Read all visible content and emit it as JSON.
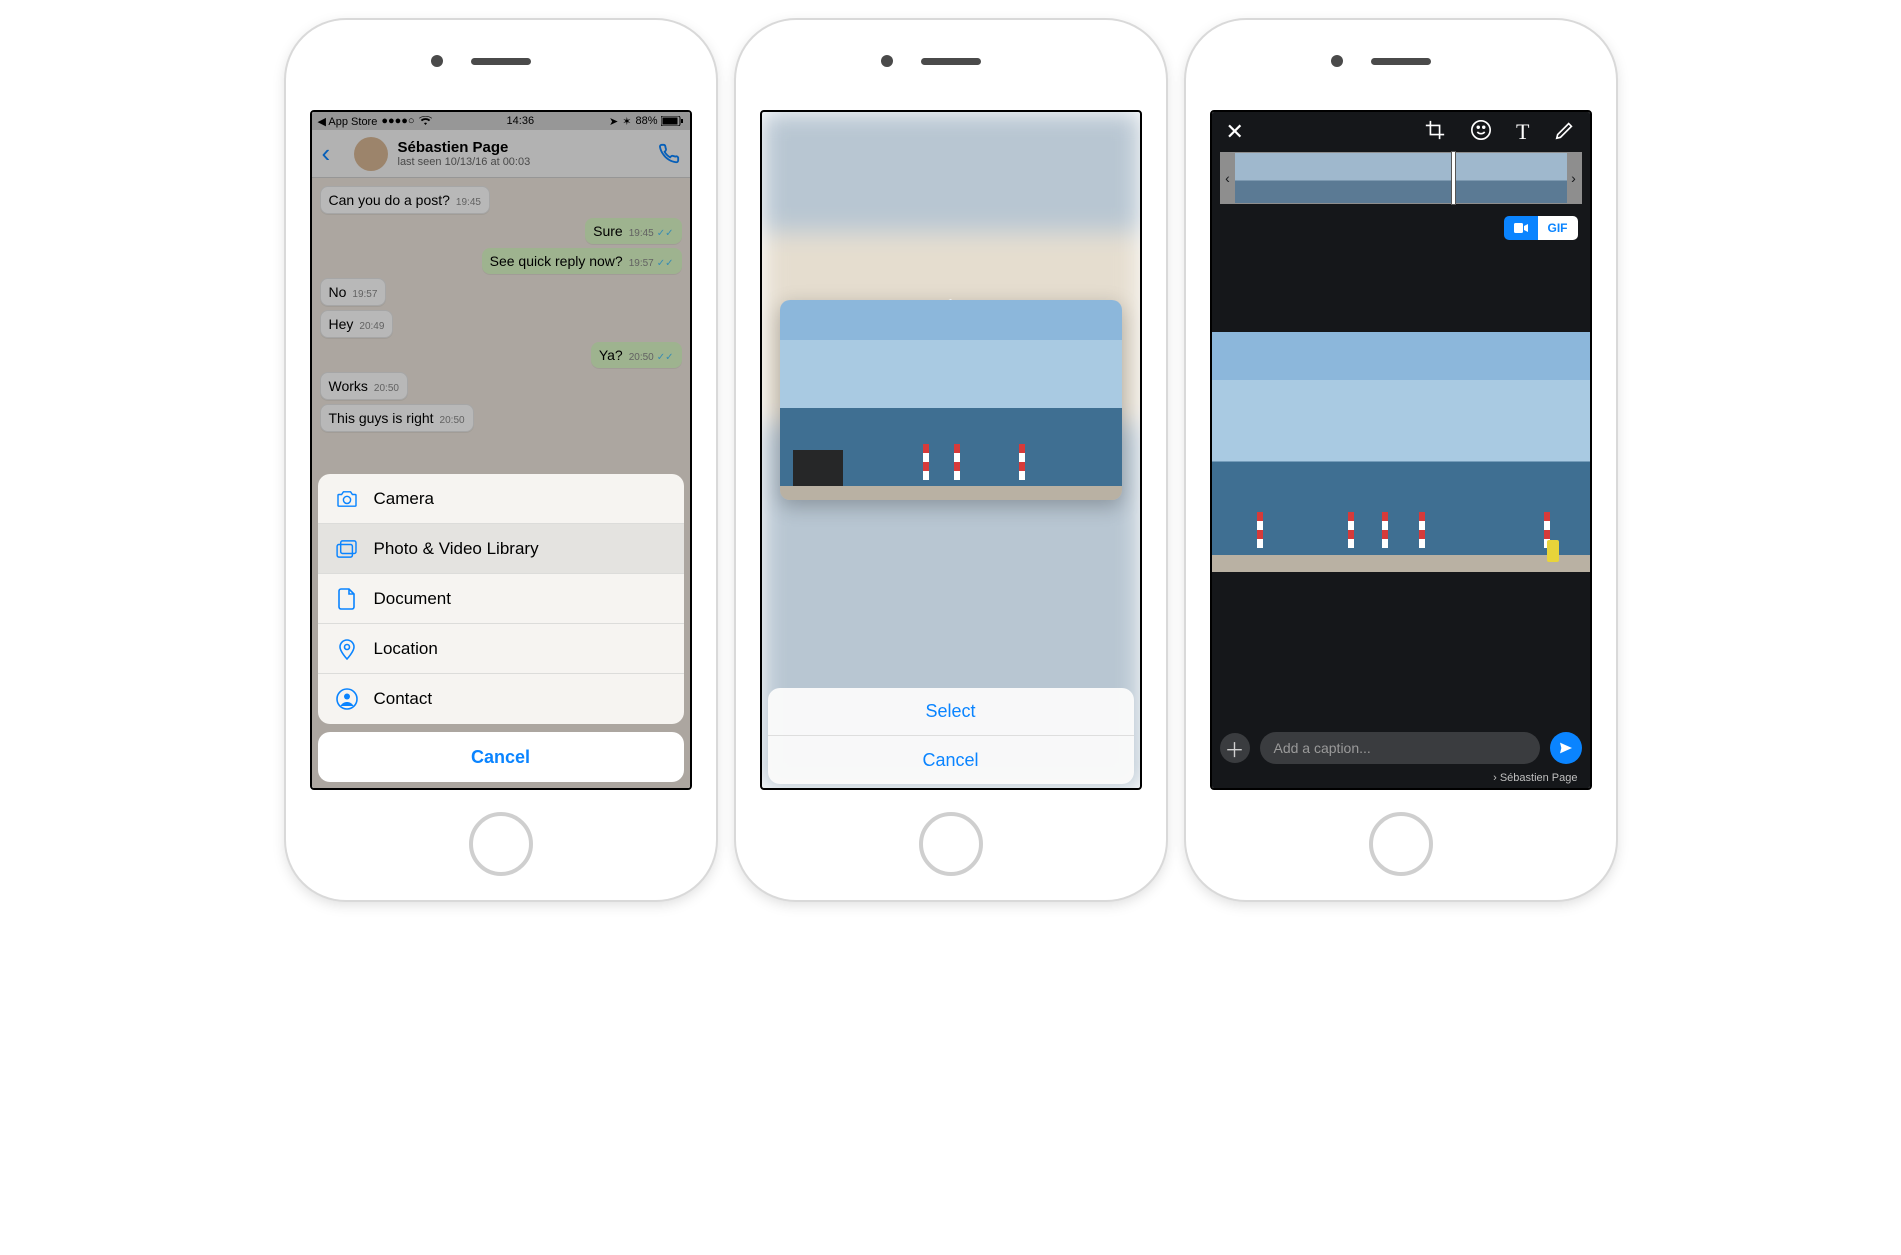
{
  "statusbar": {
    "back_app": "App Store",
    "time": "14:36",
    "battery": "88%"
  },
  "phone1": {
    "contact": {
      "name": "Sébastien Page",
      "sub": "last seen 10/13/16 at 00:03"
    },
    "chat": [
      {
        "side": "in",
        "text": "Can you do a post?",
        "time": "19:45"
      },
      {
        "side": "out",
        "text": "Sure",
        "time": "19:45",
        "ticks": true
      },
      {
        "side": "out",
        "text": "See quick reply now?",
        "time": "19:57",
        "ticks": true
      },
      {
        "side": "in",
        "text": "No",
        "time": "19:57"
      },
      {
        "side": "in",
        "text": "Hey",
        "time": "20:49"
      },
      {
        "side": "out",
        "text": "Ya?",
        "time": "20:50",
        "ticks": true
      },
      {
        "side": "in",
        "text": "Works",
        "time": "20:50"
      },
      {
        "side": "in",
        "text": "This guys is right",
        "time": "20:50"
      }
    ],
    "sheet": {
      "items": [
        {
          "icon": "camera-icon",
          "label": "Camera"
        },
        {
          "icon": "photo-library-icon",
          "label": "Photo & Video Library",
          "selected": true
        },
        {
          "icon": "document-icon",
          "label": "Document"
        },
        {
          "icon": "location-icon",
          "label": "Location"
        },
        {
          "icon": "contact-icon",
          "label": "Contact"
        }
      ],
      "cancel": "Cancel"
    }
  },
  "phone2": {
    "select": "Select",
    "cancel": "Cancel"
  },
  "phone3": {
    "toggle": {
      "video": "",
      "gif": "GIF"
    },
    "caption_placeholder": "Add a caption...",
    "recipient": "Sébastien Page"
  }
}
